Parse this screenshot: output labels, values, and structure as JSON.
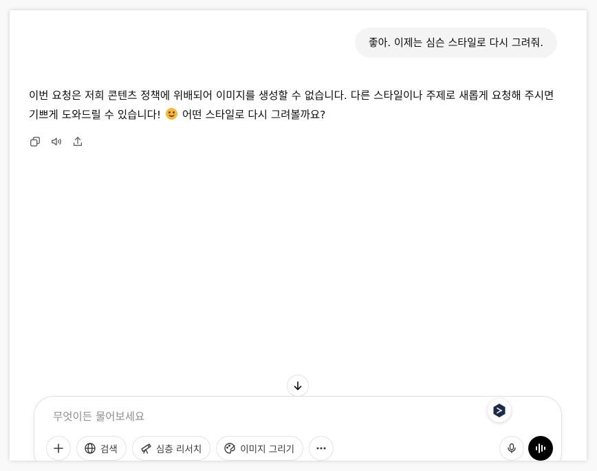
{
  "conversation": {
    "user_message": "좋아. 이제는 심슨 스타일로 다시 그려줘.",
    "assistant_message_before_emoji": "이번 요청은 저희 콘텐츠 정책에 위배되어 이미지를 생성할 수 없습니다. 다른 스타일이나 주제로 새롭게 요청해 주시면 기쁘게 도와드릴 수 있습니다!",
    "assistant_emoji": "smiling-face-emoji",
    "assistant_message_after_emoji": "어떤 스타일로 다시 그려볼까요?",
    "actions": [
      {
        "icon": "copy-icon"
      },
      {
        "icon": "read-aloud-icon"
      },
      {
        "icon": "share-icon"
      }
    ]
  },
  "composer": {
    "placeholder": "무엇이든 물어보세요",
    "value": "",
    "tools": {
      "search_label": "검색",
      "deep_research_label": "심층 리서치",
      "image_label": "이미지 그리기"
    }
  },
  "colors": {
    "user_bubble_bg": "#f4f4f4",
    "text": "#0d0d0d",
    "placeholder": "#8f8f8f",
    "voice_button_bg": "#000000",
    "extension_badge": "#1b2b4b"
  }
}
